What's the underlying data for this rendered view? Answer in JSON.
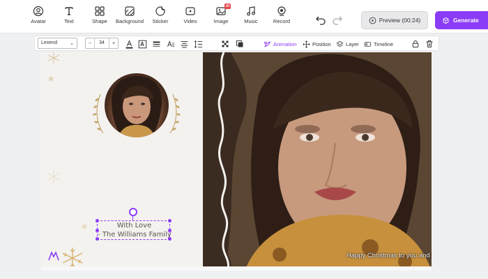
{
  "toolbar": {
    "tools": [
      {
        "key": "avatar",
        "label": "Avatar",
        "icon": "avatar-icon"
      },
      {
        "key": "text",
        "label": "Text",
        "icon": "text-icon"
      },
      {
        "key": "shape",
        "label": "Shape",
        "icon": "shape-icon"
      },
      {
        "key": "background",
        "label": "Background",
        "icon": "background-icon"
      },
      {
        "key": "sticker",
        "label": "Sticker",
        "icon": "sticker-icon"
      },
      {
        "key": "video",
        "label": "Video",
        "icon": "video-icon"
      },
      {
        "key": "image",
        "label": "Image",
        "icon": "image-icon",
        "badge": "AI"
      },
      {
        "key": "music",
        "label": "Music",
        "icon": "music-icon"
      },
      {
        "key": "record",
        "label": "Record",
        "icon": "record-icon"
      }
    ],
    "preview_label": "Preview (00:24)",
    "generate_label": "Generate",
    "accent": "#8b3cf7"
  },
  "format_bar": {
    "font": "Lexend",
    "font_size": "34",
    "minus": "−",
    "plus": "+",
    "text_a": "A",
    "animation_label": "Animation",
    "position_label": "Position",
    "layer_label": "Layer",
    "timeline_label": "Timeline"
  },
  "canvas": {
    "text_line1": "With Love",
    "text_line2": "- The Williams Family",
    "subtitle": "Happy Christmas to you and yours!"
  }
}
